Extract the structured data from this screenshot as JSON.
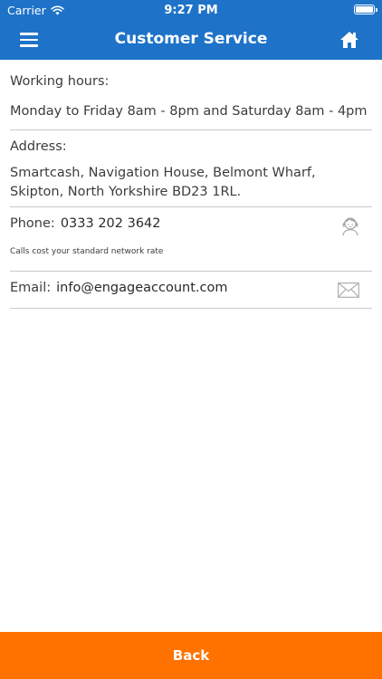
{
  "status_bar": {
    "carrier": "Carrier",
    "time": "9:27 PM"
  },
  "nav": {
    "title": "Customer Service",
    "menu_icon": "hamburger-menu-icon",
    "home_icon": "home-icon"
  },
  "sections": {
    "hours": {
      "label": "Working hours:",
      "value": "Monday to Friday 8am - 8pm and Saturday 8am - 4pm"
    },
    "address": {
      "label": "Address:",
      "value": "Smartcash, Navigation House, Belmont Wharf, Skipton, North Yorkshire BD23 1RL."
    },
    "phone": {
      "label": "Phone:",
      "value": "0333 202 3642",
      "note": "Calls cost your standard network rate",
      "icon": "customer-support-icon"
    },
    "email": {
      "label": "Email:",
      "value": "info@engageaccount.com",
      "icon": "mail-icon"
    }
  },
  "footer": {
    "back_label": "Back"
  },
  "colors": {
    "header": "#1e73c8",
    "back_button": "#ff7200",
    "divider": "#c9c9c9",
    "text": "#3c3c3c"
  }
}
